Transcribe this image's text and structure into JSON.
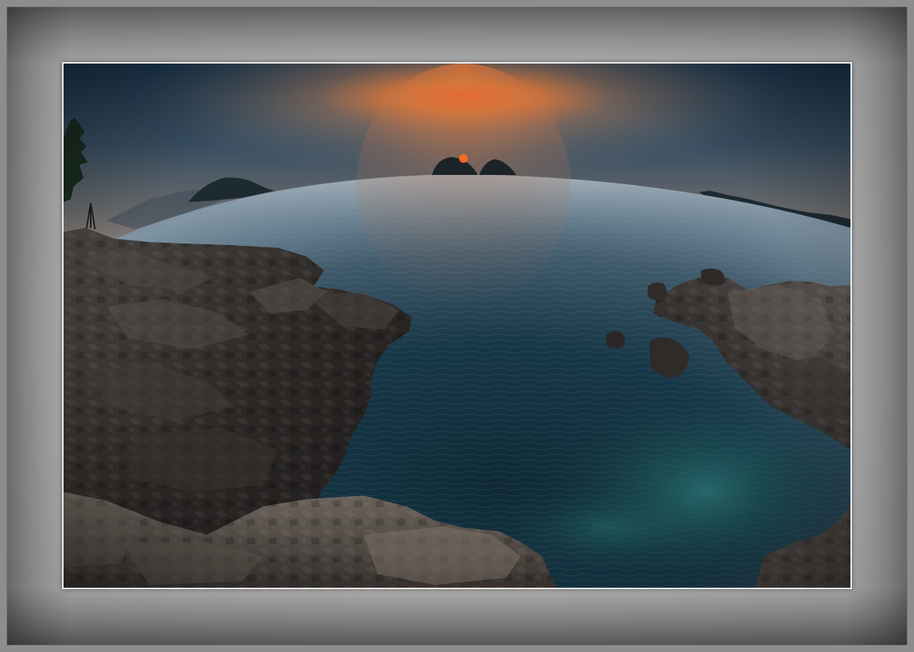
{
  "scene": {
    "subject": "rocky-coast-sunset",
    "colors": {
      "sky_top": "#1c3a52",
      "sky_glow": "#f07a2a",
      "sun_core": "#ff5a14",
      "sea_far": "#8ea3b3",
      "sea_mid": "#274456",
      "sea_near": "#0f2430",
      "sea_teal": "#1d5a5c",
      "rock_dark": "#2a2828",
      "rock_light": "#6a635c",
      "mat_gray": "#a9a9a9",
      "photo_border": "#f2f2f2"
    }
  }
}
